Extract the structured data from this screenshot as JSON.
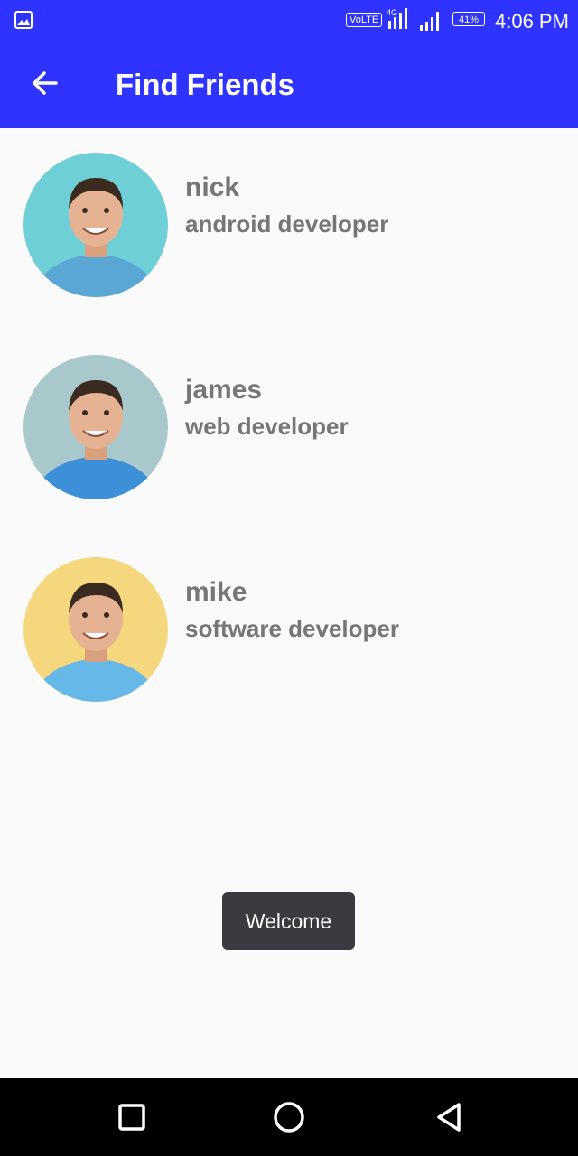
{
  "status_bar": {
    "volte": "VoLTE",
    "network": "4G",
    "battery": "41%",
    "time": "4:06 PM"
  },
  "app_bar": {
    "title": "Find Friends",
    "back_icon": "arrow-back-icon"
  },
  "friends": [
    {
      "name": "nick",
      "role": "android developer",
      "avatar_bg": "#6fcfd6",
      "shirt": "#5aa7d6"
    },
    {
      "name": "james",
      "role": "web developer",
      "avatar_bg": "#a9c8cc",
      "shirt": "#3d8fd8"
    },
    {
      "name": "mike",
      "role": "software developer",
      "avatar_bg": "#f5d77d",
      "shirt": "#66b8e8"
    }
  ],
  "toast": {
    "text": "Welcome"
  },
  "nav_bar": {
    "icons": [
      "recents-square-icon",
      "home-circle-icon",
      "back-triangle-icon"
    ]
  }
}
